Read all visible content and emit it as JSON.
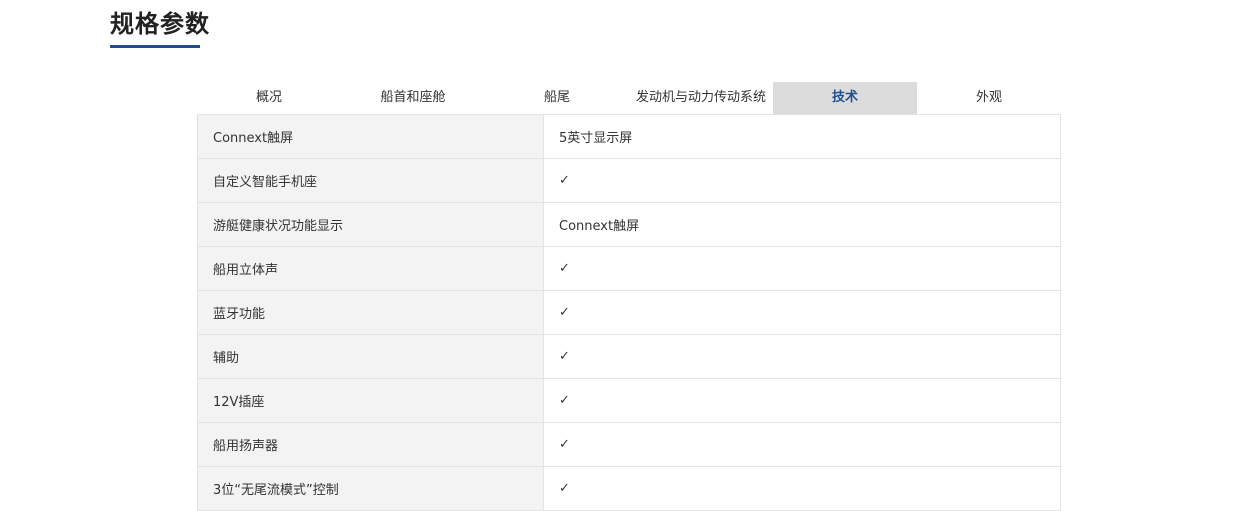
{
  "section": {
    "title": "规格参数"
  },
  "tabs": [
    {
      "label": "概况",
      "active": false
    },
    {
      "label": "船首和座舱",
      "active": false
    },
    {
      "label": "船尾",
      "active": false
    },
    {
      "label": "发动机与动力传动系统",
      "active": false
    },
    {
      "label": "技术",
      "active": true
    },
    {
      "label": "外观",
      "active": false
    }
  ],
  "specs": [
    {
      "label": "Connext触屏",
      "value": "5英寸显示屏"
    },
    {
      "label": "自定义智能手机座",
      "value": "✓"
    },
    {
      "label": "游艇健康状况功能显示",
      "value": "Connext触屏"
    },
    {
      "label": "船用立体声",
      "value": "✓"
    },
    {
      "label": "蓝牙功能",
      "value": "✓"
    },
    {
      "label": "辅助",
      "value": "✓"
    },
    {
      "label": "12V插座",
      "value": "✓"
    },
    {
      "label": "船用扬声器",
      "value": "✓"
    },
    {
      "label": "3位“无尾流模式”控制",
      "value": "✓"
    }
  ],
  "colors": {
    "accent": "#1f4e8c",
    "active_tab_bg": "#dcdcdc",
    "label_cell_bg": "#f3f3f3",
    "border": "#e3e3e3"
  }
}
